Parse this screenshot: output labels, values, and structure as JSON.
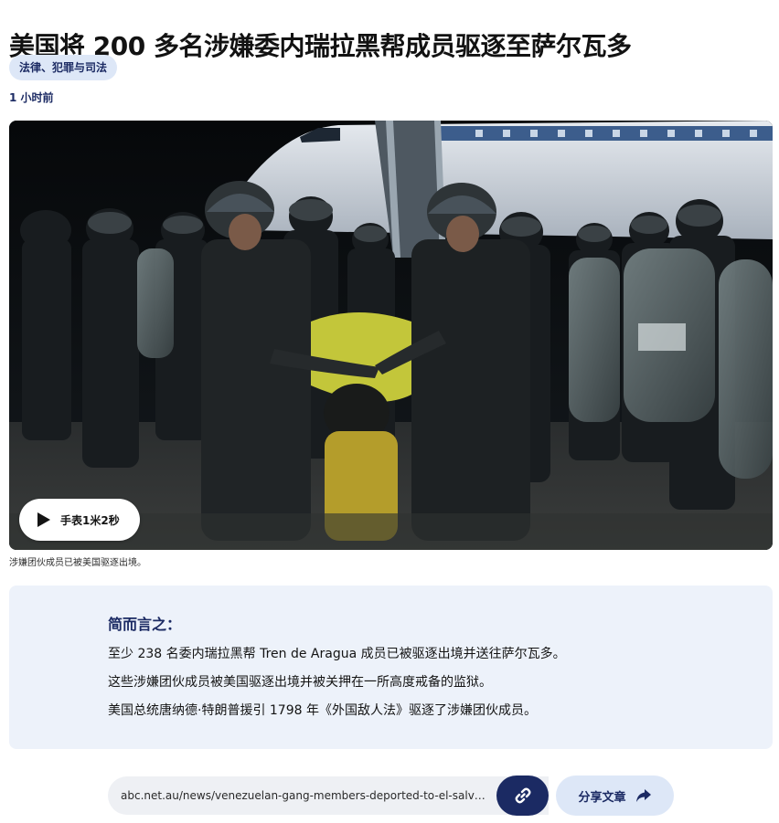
{
  "article": {
    "headline": "美国将 200 多名涉嫌委内瑞拉黑帮成员驱逐至萨尔瓦多",
    "topic_tag": "法律、犯罪与司法",
    "published": "1 小时前"
  },
  "media": {
    "play_label": "手表1米2秒",
    "caption": "涉嫌团伙成员已被美国驱逐出境。",
    "play_icon": "play-icon"
  },
  "summary": {
    "heading": "简而言之：",
    "points": [
      "至少 238 名委内瑞拉黑帮 Tren de Aragua 成员已被驱逐出境并送往萨尔瓦多。",
      "这些涉嫌团伙成员被美国驱逐出境并被关押在一所高度戒备的监狱。",
      "美国总统唐纳德·特朗普援引 1798 年《外国敌人法》驱逐了涉嫌团伙成员。"
    ]
  },
  "share": {
    "url": "abc.net.au/news/venezuelan-gang-members-deported-to-el-salvador",
    "copy_icon": "link-icon",
    "share_label": "分享文章",
    "share_icon": "share-arrow-icon"
  },
  "colors": {
    "brand_navy": "#1b2a63",
    "tag_background": "#dde7f7",
    "summary_background": "#edf2fa"
  }
}
